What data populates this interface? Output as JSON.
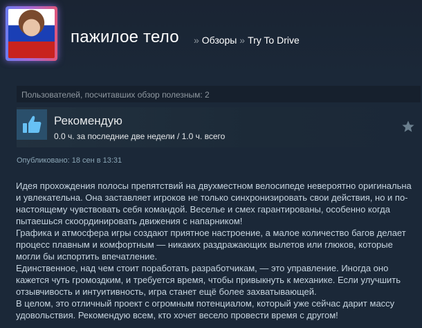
{
  "profile": {
    "name": "пажилое тело",
    "breadcrumbs": [
      {
        "sep": "»",
        "label": "Обзоры"
      },
      {
        "sep": "»",
        "label": "Try To Drive"
      }
    ]
  },
  "review": {
    "helpful_text": "Пользователей, посчитавших обзор полезным: 2",
    "recommendation": "Рекомендую",
    "hours": "0.0 ч. за последние две недели / 1.0 ч. всего",
    "posted": "Опубликовано: 18 сен в 13:31",
    "paragraphs": [
      "Идея прохождения полосы препятствий на двухместном велосипеде невероятно оригинальна и увлекательна. Она заставляет игроков не только синхронизировать свои действия, но и по-настоящему чувствовать себя командой. Веселье и смех гарантированы, особенно когда пытаешься скоординировать движения с напарником!",
      "Графика и атмосфера игры создают приятное настроение, а малое количество багов делает процесс плавным и комфортным — никаких раздражающих вылетов или глюков, которые могли бы испортить впечатление.",
      "Единственное, над чем стоит поработать разработчикам, — это управление. Иногда оно кажется чуть громоздким, и требуется время, чтобы привыкнуть к механике. Если улучшить отзывчивость и интуитивность, игра станет ещё более захватывающей.",
      "В целом, это отличный проект с огромным потенциалом, который уже сейчас дарит массу удовольствия. Рекомендую всем, кто хочет весело провести время с другом!"
    ]
  },
  "colors": {
    "background": "#1b2838",
    "thumb_box": "#2a4f6b",
    "thumb_icon": "#67c1f5",
    "text": "#c6d4df",
    "muted": "#8f98a0"
  },
  "icons": {
    "thumb": "thumbs-up-icon",
    "award": "star-icon"
  }
}
